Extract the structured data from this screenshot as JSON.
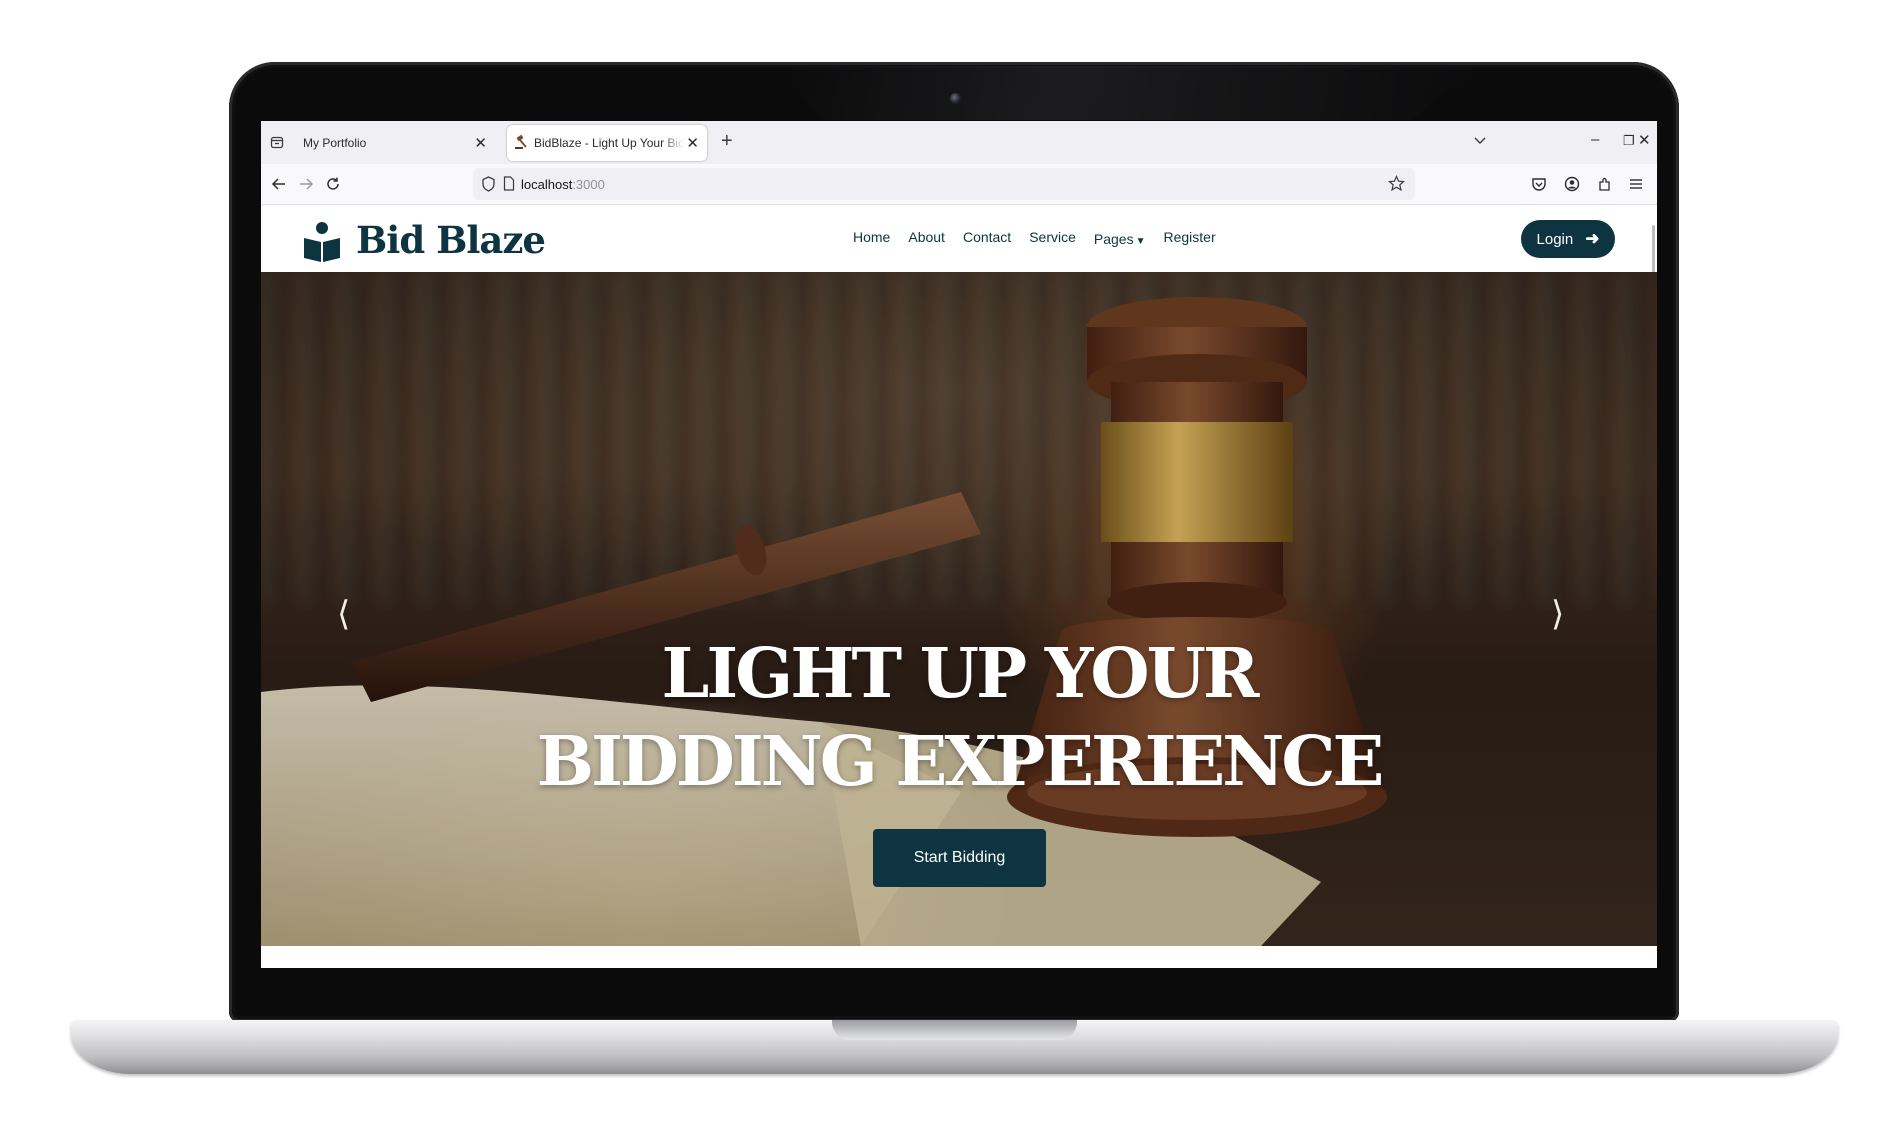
{
  "browser": {
    "tabs": [
      {
        "label": "My Portfolio",
        "active": false
      },
      {
        "label": "BidBlaze - Light Up Your Bidding Experience",
        "active": true
      }
    ],
    "url_host": "localhost",
    "url_port": ":3000"
  },
  "site": {
    "brand": "Bid Blaze",
    "menu": [
      "Home",
      "About",
      "Contact",
      "Service",
      "Pages",
      "Register"
    ],
    "login_label": "Login",
    "hero_title_line1": "LIGHT UP YOUR",
    "hero_title_line2": "BIDDING EXPERIENCE",
    "cta_label": "Start Bidding"
  },
  "colors": {
    "brand_dark": "#0e3441",
    "chrome_bg": "#f0f0f4"
  },
  "icons": {
    "tab_list": "tab-list-icon",
    "back": "arrow-left-icon",
    "forward": "arrow-right-icon",
    "reload": "reload-icon",
    "shield": "shield-icon",
    "page": "page-icon",
    "bookmark": "star-icon",
    "pocket": "pocket-icon",
    "account": "account-icon",
    "extensions": "puzzle-icon",
    "menu": "hamburger-icon"
  }
}
